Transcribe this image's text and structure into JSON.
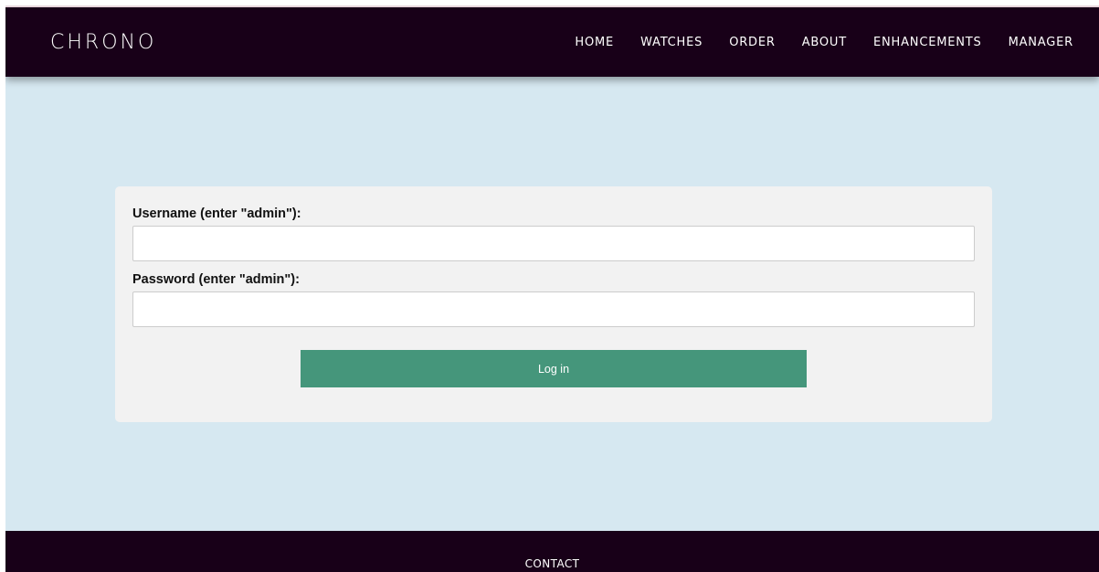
{
  "navbar": {
    "brand": "CHRONO",
    "links": [
      "HOME",
      "WATCHES",
      "ORDER",
      "ABOUT",
      "ENHANCEMENTS",
      "MANAGER"
    ]
  },
  "login": {
    "username_label": "Username (enter \"admin\"):",
    "username_value": "",
    "password_label": "Password (enter \"admin\"):",
    "password_value": "",
    "button_label": "Log in"
  },
  "footer": {
    "contact_label": "CONTACT"
  },
  "colors": {
    "navbar_bg": "#180018",
    "page_bg": "#d6e8f1",
    "card_bg": "#f2f2f2",
    "button_bg": "#45967b"
  }
}
